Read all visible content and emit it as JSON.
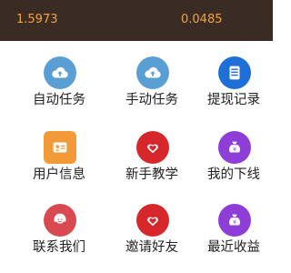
{
  "header": {
    "left_value": "1.5973",
    "right_value": "0.0485",
    "value_color": "#f0a43a",
    "background": "#3a2c25"
  },
  "menu": {
    "items": [
      {
        "label": "自动任务",
        "icon": "cloud-upload-icon",
        "color": "#5a9fd3"
      },
      {
        "label": "手动任务",
        "icon": "cloud-upload-icon",
        "color": "#5a9fd3"
      },
      {
        "label": "提现记录",
        "icon": "document-list-icon",
        "color": "#1f6fd8"
      },
      {
        "label": "用户信息",
        "icon": "id-card-icon",
        "color": "#f29a37"
      },
      {
        "label": "新手教学",
        "icon": "hearts-icon",
        "color": "#d6282c"
      },
      {
        "label": "我的下线",
        "icon": "money-bag-icon",
        "color": "#8e3dd6"
      },
      {
        "label": "联系我们",
        "icon": "support-agent-icon",
        "color": "#d84a4f"
      },
      {
        "label": "邀请好友",
        "icon": "hearts-icon",
        "color": "#d6282c"
      },
      {
        "label": "最近收益",
        "icon": "money-bag-icon",
        "color": "#8e3dd6"
      }
    ]
  }
}
